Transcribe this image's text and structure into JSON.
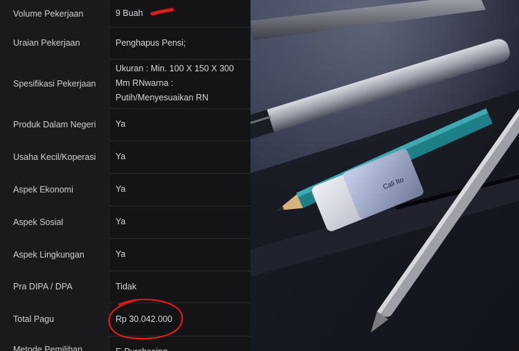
{
  "table": {
    "rows": [
      {
        "label": "Volume Pekerjaan",
        "value": "9 Buah"
      },
      {
        "label": "Uraian Pekerjaan",
        "value": "Penghapus Pensi;"
      },
      {
        "label": "Spesifikasi Pekerjaan",
        "value": "Ukuran : Min. 100 X 150 X 300 Mm RNwarna : Putih/Menyesuaikan RN"
      },
      {
        "label": "Produk Dalam Negeri",
        "value": "Ya"
      },
      {
        "label": "Usaha Kecil/Koperasi",
        "value": "Ya"
      },
      {
        "label": "Aspek Ekonomi",
        "value": "Ya"
      },
      {
        "label": "Aspek Sosial",
        "value": "Ya"
      },
      {
        "label": "Aspek Lingkungan",
        "value": "Ya"
      },
      {
        "label": "Pra DIPA / DPA",
        "value": "Tidak"
      },
      {
        "label": "Total Pagu",
        "value": "Rp 30.042.000"
      },
      {
        "label": "Metode Pemilihan",
        "value": "E-Purchasing"
      }
    ]
  },
  "photo": {
    "eraser_text": "Cali Ito"
  },
  "colors": {
    "annotation_red": "#e01b1b",
    "pencil_teal": "#1f7f87"
  }
}
